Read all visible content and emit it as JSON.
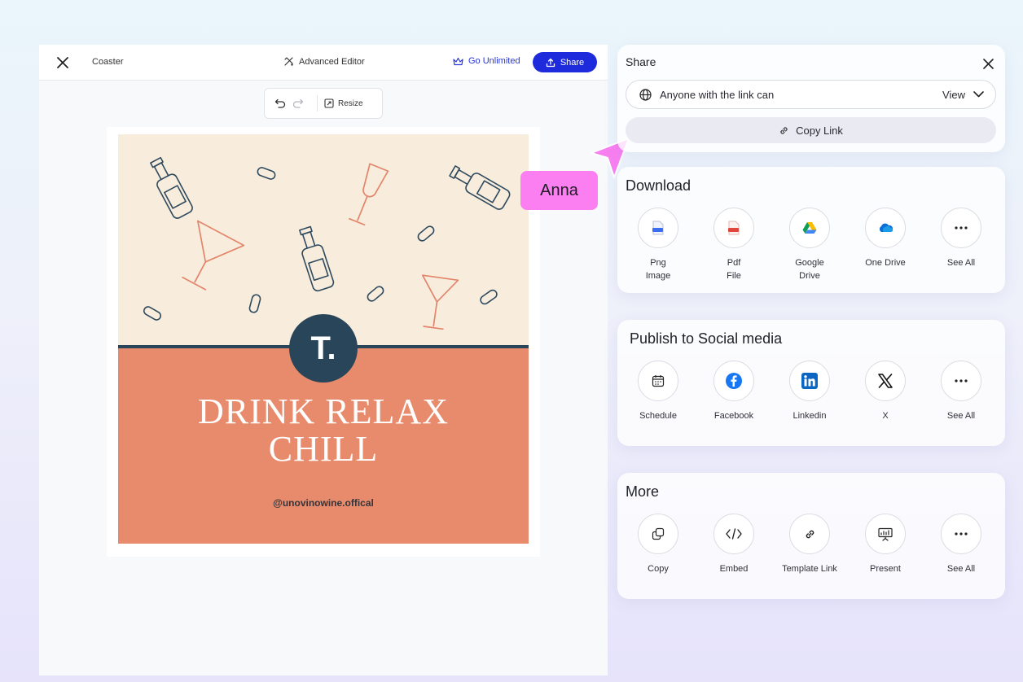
{
  "editor": {
    "title": "Coaster",
    "advanced_editor": "Advanced Editor",
    "go_unlimited": "Go Unlimited",
    "share_button": "Share",
    "resize": "Resize"
  },
  "design": {
    "logo_letter": "T.",
    "headline_line1": "DRINK RELAX",
    "headline_line2": "CHILL",
    "handle": "@unovinowine.offical"
  },
  "collaborator": {
    "name": "Anna",
    "color": "#fb7ff0"
  },
  "share_panel": {
    "title": "Share",
    "permission_text": "Anyone with the link can",
    "permission_value": "View",
    "copy_link": "Copy Link"
  },
  "download": {
    "title": "Download",
    "items": [
      {
        "line1": "Png",
        "line2": "Image",
        "icon": "png-file-icon"
      },
      {
        "line1": "Pdf",
        "line2": "File",
        "icon": "pdf-file-icon"
      },
      {
        "line1": "Google",
        "line2": "Drive",
        "icon": "google-drive-icon"
      },
      {
        "line1": "One Drive",
        "line2": "",
        "icon": "onedrive-icon"
      },
      {
        "line1": "See All",
        "line2": "",
        "icon": "more-icon"
      }
    ]
  },
  "social": {
    "title": "Publish to Social media",
    "items": [
      {
        "label": "Schedule",
        "icon": "calendar-icon"
      },
      {
        "label": "Facebook",
        "icon": "facebook-icon"
      },
      {
        "label": "Linkedin",
        "icon": "linkedin-icon"
      },
      {
        "label": "X",
        "icon": "x-icon"
      },
      {
        "label": "See All",
        "icon": "more-icon"
      }
    ]
  },
  "more": {
    "title": "More",
    "items": [
      {
        "label": "Copy",
        "icon": "copy-icon"
      },
      {
        "label": "Embed",
        "icon": "code-icon"
      },
      {
        "label": "Template Link",
        "icon": "link-icon"
      },
      {
        "label": "Present",
        "icon": "presentation-icon"
      },
      {
        "label": "See All",
        "icon": "more-icon"
      }
    ]
  },
  "colors": {
    "accent": "#1d2bdc",
    "design_top": "#f8eddd",
    "design_bottom": "#e88b6c",
    "design_navy": "#28455a"
  }
}
